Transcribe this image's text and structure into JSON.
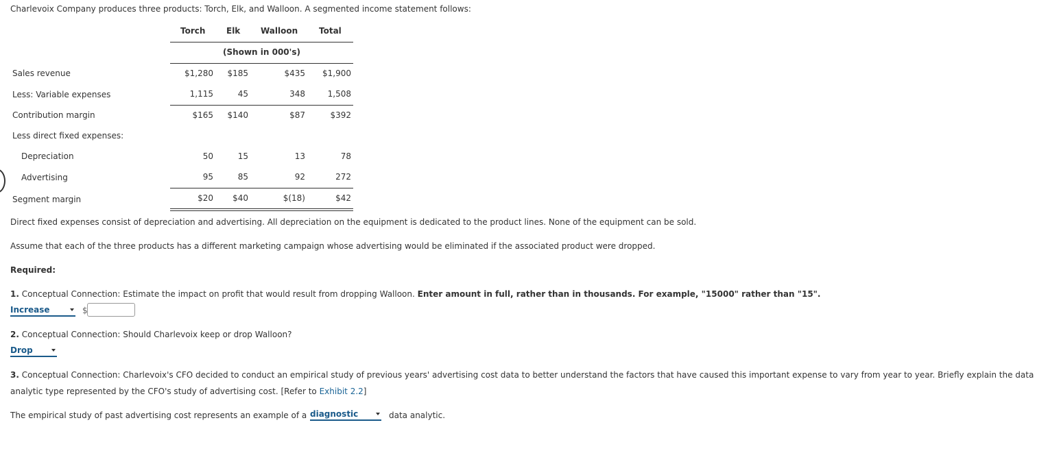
{
  "intro": "Charlevoix Company produces three products: Torch, Elk, and Walloon. A segmented income statement follows:",
  "table": {
    "columns": [
      "Torch",
      "Elk",
      "Walloon",
      "Total"
    ],
    "unit_note": "(Shown in 000's)",
    "rows": [
      {
        "label": "Sales revenue",
        "values": [
          "$1,280",
          "$185",
          "$435",
          "$1,900"
        ]
      },
      {
        "label": "Less: Variable expenses",
        "values": [
          "1,115",
          "45",
          "348",
          "1,508"
        ]
      },
      {
        "label": "Contribution margin",
        "values": [
          "$165",
          "$140",
          "$87",
          "$392"
        ]
      },
      {
        "label": "Less direct fixed expenses:",
        "values": [
          "",
          "",
          "",
          ""
        ]
      },
      {
        "label": "Depreciation",
        "values": [
          "50",
          "15",
          "13",
          "78"
        ]
      },
      {
        "label": "Advertising",
        "values": [
          "95",
          "85",
          "92",
          "272"
        ]
      },
      {
        "label": "Segment margin",
        "values": [
          "$20",
          "$40",
          "$(18)",
          "$42"
        ]
      }
    ]
  },
  "para1": "Direct fixed expenses consist of depreciation and advertising. All depreciation on the equipment is dedicated to the product lines. None of the equipment can be sold.",
  "para2": "Assume that each of the three products has a different marketing campaign whose advertising would be eliminated if the associated product were dropped.",
  "required_label": "Required:",
  "q1": {
    "number": "1.",
    "text": "Conceptual Connection: Estimate the impact on profit that would result from dropping Walloon.",
    "bold_instruction": "Enter amount in full, rather than in thousands. For example, \"15000\" rather than \"15\".",
    "select_value": "Increase",
    "currency": "$",
    "amount_value": ""
  },
  "q2": {
    "number": "2.",
    "text": "Conceptual Connection: Should Charlevoix keep or drop Walloon?",
    "select_value": "Drop"
  },
  "q3": {
    "number": "3.",
    "text_line1": "Conceptual Connection: Charlevoix's CFO decided to conduct an empirical study of previous years' advertising cost data to better understand the factors that have caused this important expense to vary from year to year. Briefly explain the data",
    "text_line2": "analytic type represented by the CFO's study of advertising cost. [Refer to",
    "link": "Exhibit 2.2",
    "text_end": "]",
    "answer_prefix": "The empirical study of past advertising cost represents an example of a",
    "select_value": "diagnostic",
    "answer_suffix": "data analytic."
  }
}
